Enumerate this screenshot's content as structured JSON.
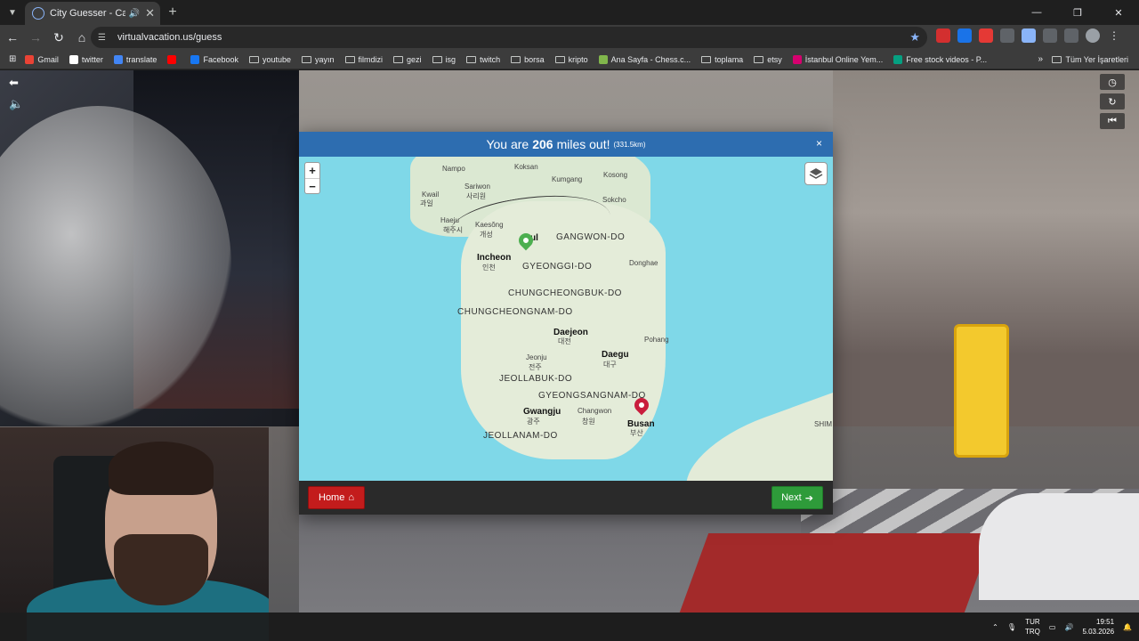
{
  "browser": {
    "tab_title": "City Guesser - Can you gue",
    "url": "virtualvacation.us/guess",
    "window_controls": [
      "minimize-icon",
      "restore-icon",
      "close-icon"
    ]
  },
  "bookmarks": [
    {
      "label": "Gmail",
      "icon": "gmail-icon",
      "color": "#ea4335"
    },
    {
      "label": "twitter",
      "icon": "x-icon",
      "color": "#ffffff"
    },
    {
      "label": "translate",
      "icon": "translate-icon",
      "color": "#4285f4"
    },
    {
      "label": "",
      "icon": "youtube-icon",
      "color": "#ff0000"
    },
    {
      "label": "Facebook",
      "icon": "facebook-icon",
      "color": "#1877f2"
    },
    {
      "label": "youtube",
      "icon": "folder-icon"
    },
    {
      "label": "yayın",
      "icon": "folder-icon"
    },
    {
      "label": "filmdizi",
      "icon": "folder-icon"
    },
    {
      "label": "gezi",
      "icon": "folder-icon"
    },
    {
      "label": "isg",
      "icon": "folder-icon"
    },
    {
      "label": "twitch",
      "icon": "folder-icon"
    },
    {
      "label": "borsa",
      "icon": "folder-icon"
    },
    {
      "label": "kripto",
      "icon": "folder-icon"
    },
    {
      "label": "Ana Sayfa - Chess.c...",
      "icon": "chess-icon",
      "color": "#81b64c"
    },
    {
      "label": "toplama",
      "icon": "folder-icon"
    },
    {
      "label": "etsy",
      "icon": "folder-icon"
    },
    {
      "label": "İstanbul Online Yem...",
      "icon": "yemek-icon",
      "color": "#d6006f"
    },
    {
      "label": "Free stock videos - P...",
      "icon": "pexels-icon",
      "color": "#05a081"
    }
  ],
  "all_bookmarks": "Tüm Yer İşaretleri",
  "modal": {
    "header_prefix": "You are",
    "distance_miles": "206",
    "header_suffix": "miles out!",
    "distance_km": "(331.5km)",
    "close": "×",
    "home_label": "Home",
    "next_label": "Next"
  },
  "map": {
    "zoom_in": "+",
    "zoom_out": "−",
    "labels": [
      {
        "text": "Nampo",
        "cls": "sub"
      },
      {
        "text": "Koksan",
        "cls": "sub"
      },
      {
        "text": "Kumgang",
        "cls": "sub"
      },
      {
        "text": "Kosong",
        "cls": "sub"
      },
      {
        "text": "Sariwon",
        "cls": "sub"
      },
      {
        "text": "사리원",
        "cls": "sub"
      },
      {
        "text": "Kwail",
        "cls": "sub"
      },
      {
        "text": "과일",
        "cls": "sub"
      },
      {
        "text": "Sokcho",
        "cls": "sub"
      },
      {
        "text": "Haeju",
        "cls": "sub"
      },
      {
        "text": "해주시",
        "cls": "sub"
      },
      {
        "text": "Kaesŏng",
        "cls": "sub"
      },
      {
        "text": "개성",
        "cls": "sub"
      },
      {
        "text": "GANGWON-DO",
        "cls": "region"
      },
      {
        "text": "Incheon",
        "cls": "city"
      },
      {
        "text": "인천",
        "cls": "sub"
      },
      {
        "text": "GYEONGGI-DO",
        "cls": "region"
      },
      {
        "text": "Donghae",
        "cls": "sub"
      },
      {
        "text": "CHUNGCHEONGBUK-DO",
        "cls": "region"
      },
      {
        "text": "CHUNGCHEONGNAM-DO",
        "cls": "region"
      },
      {
        "text": "Daejeon",
        "cls": "city"
      },
      {
        "text": "대전",
        "cls": "sub"
      },
      {
        "text": "Pohang",
        "cls": "sub"
      },
      {
        "text": "Jeonju",
        "cls": "sub"
      },
      {
        "text": "전주",
        "cls": "sub"
      },
      {
        "text": "Daegu",
        "cls": "city"
      },
      {
        "text": "대구",
        "cls": "sub"
      },
      {
        "text": "JEOLLABUK-DO",
        "cls": "region"
      },
      {
        "text": "GYEONGSANGNAM-DO",
        "cls": "region"
      },
      {
        "text": "Gwangju",
        "cls": "city"
      },
      {
        "text": "광주",
        "cls": "sub"
      },
      {
        "text": "Changwon",
        "cls": "sub"
      },
      {
        "text": "창원",
        "cls": "sub"
      },
      {
        "text": "Busan",
        "cls": "city"
      },
      {
        "text": "부산",
        "cls": "sub"
      },
      {
        "text": "JEOLLANAM-DO",
        "cls": "region"
      },
      {
        "text": "SHIM",
        "cls": "sub"
      },
      {
        "text": "ul",
        "cls": "city"
      }
    ]
  },
  "taskbar": {
    "lang_top": "TUR",
    "lang_bottom": "TRQ",
    "time": "19:51",
    "date": "5.03.2026"
  },
  "colors": {
    "modal_header": "#2d6db0",
    "home_button": "#c31c1c",
    "next_button": "#2e9b3a",
    "guess_pin": "#4caf50",
    "actual_pin": "#c91d3c"
  }
}
